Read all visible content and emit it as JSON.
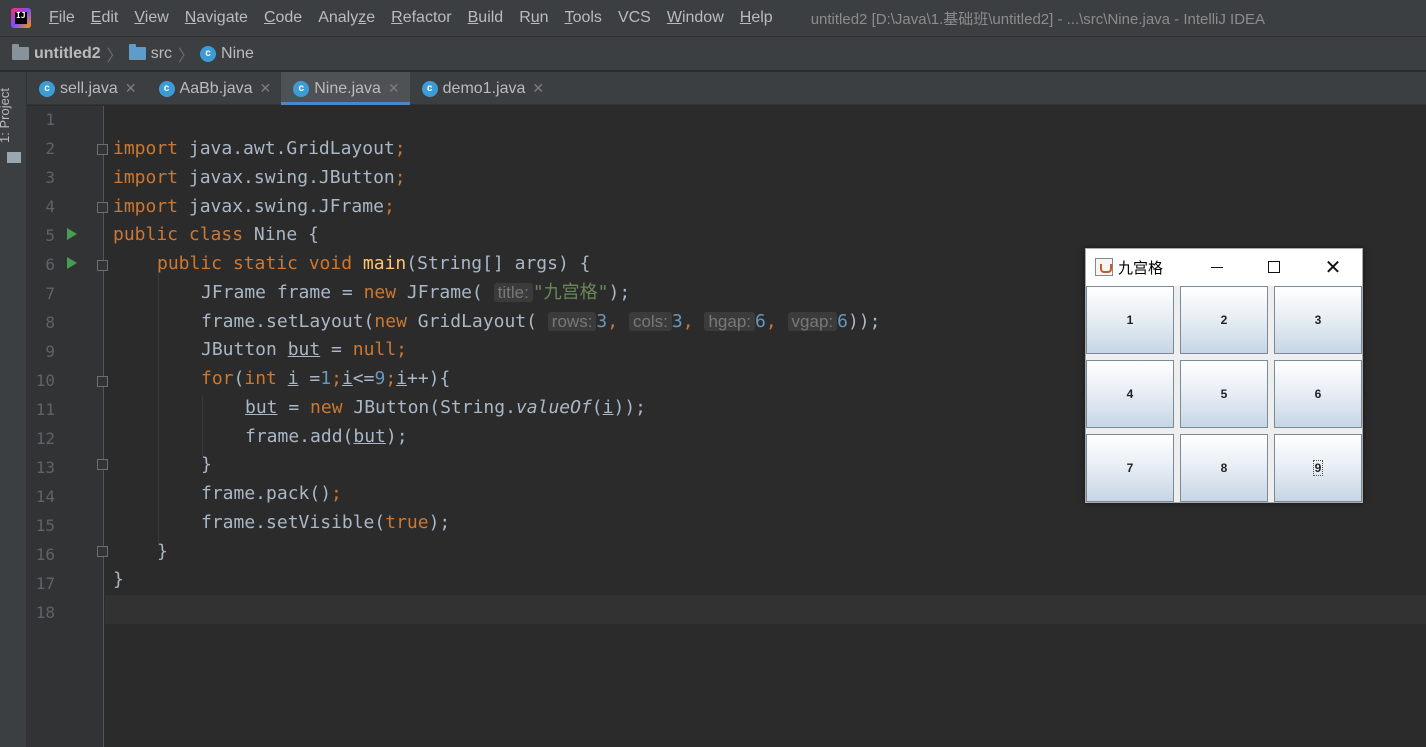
{
  "app": {
    "logo_text": "IJ"
  },
  "menu": [
    "File",
    "Edit",
    "View",
    "Navigate",
    "Code",
    "Analyze",
    "Refactor",
    "Build",
    "Run",
    "Tools",
    "VCS",
    "Window",
    "Help"
  ],
  "menu_mnemonics": [
    "F",
    "E",
    "V",
    "N",
    "C",
    "z",
    "R",
    "B",
    "u",
    "T",
    "",
    "W",
    "H"
  ],
  "window_title": "untitled2 [D:\\Java\\1.基础班\\untitled2] - ...\\src\\Nine.java - IntelliJ IDEA",
  "breadcrumb": {
    "project": "untitled2",
    "folder": "src",
    "file": "Nine"
  },
  "tool_window": {
    "project_label": "1: Project"
  },
  "tabs": [
    {
      "label": "sell.java",
      "active": false
    },
    {
      "label": "AaBb.java",
      "active": false
    },
    {
      "label": "Nine.java",
      "active": true
    },
    {
      "label": "demo1.java",
      "active": false
    }
  ],
  "line_numbers": [
    "1",
    "2",
    "3",
    "4",
    "5",
    "6",
    "7",
    "8",
    "9",
    "10",
    "11",
    "12",
    "13",
    "14",
    "15",
    "16",
    "17",
    "18"
  ],
  "code": {
    "l2": [
      "import",
      " java.awt.GridLayout",
      ";"
    ],
    "l3": [
      "import",
      " javax.swing.JButton",
      ";"
    ],
    "l4": [
      "import",
      " javax.swing.JFrame",
      ";"
    ],
    "l5": [
      "public class",
      " Nine {"
    ],
    "l6": [
      "public static void ",
      "main",
      "(String[] args) {"
    ],
    "l7": [
      "JFrame frame = ",
      "new",
      " JFrame( ",
      "title:",
      "\"九宫格\"",
      ");"
    ],
    "l8": [
      "frame.setLayout(",
      "new",
      " GridLayout( ",
      "rows:",
      "3",
      ", ",
      "cols:",
      "3",
      ", ",
      "hgap:",
      "6",
      ", ",
      "vgap:",
      "6",
      "));"
    ],
    "l9": [
      "JButton ",
      "but",
      " = ",
      "null",
      ";"
    ],
    "l10": [
      "for",
      "(",
      "int",
      " ",
      "i",
      " =",
      "1",
      ";",
      "i",
      "<=",
      "9",
      ";",
      "i",
      "++){"
    ],
    "l11": [
      "but",
      " = ",
      "new",
      " JButton(String.",
      "valueOf",
      "(",
      "i",
      "));"
    ],
    "l12": [
      "frame.add(",
      "but",
      ");"
    ],
    "l13": "}",
    "l14": [
      "frame.pack()",
      ";"
    ],
    "l15": [
      "frame.setVisible(",
      "true",
      ");"
    ],
    "l16": "}",
    "l17": "}"
  },
  "swing_window": {
    "title": "九宫格",
    "close_glyph": "✕",
    "buttons": [
      "1",
      "2",
      "3",
      "4",
      "5",
      "6",
      "7",
      "8",
      "9"
    ]
  },
  "colors": {
    "keyword": "#cc7832",
    "method": "#ffc66d",
    "number": "#6897bb",
    "string": "#6a8759",
    "text": "#a9b7c6",
    "accent": "#4a88c7",
    "run": "#499c54"
  }
}
